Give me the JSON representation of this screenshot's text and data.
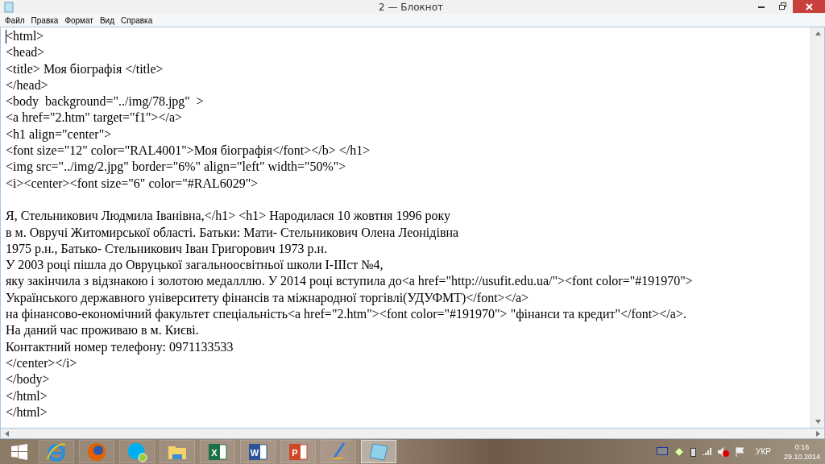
{
  "window": {
    "title": "2 — Блокнот"
  },
  "menu": [
    "Файл",
    "Правка",
    "Формат",
    "Вид",
    "Справка"
  ],
  "editor": {
    "blocks": [
      [
        "<html>",
        "<head>",
        "<title> Моя біографія </title>",
        "</head>",
        "<body  background=\"../img/78.jpg\"  >",
        "<a href=\"2.htm\" target=\"f1\"></a>",
        "<h1 align=\"center\">",
        "<font size=\"12\" color=\"RAL4001\">Моя біографія</font></b> </h1>",
        "<img src=\"../img/2.jpg\" border=\"6%\" align=\"left\" width=\"50%\">",
        "<i><center><font size=\"6\" color=\"#RAL6029\">"
      ],
      [
        "Я, Стельникович Людмила Іванівна,</h1> <h1> Народилася 10 жовтня 1996 року",
        "в м. Овручі Житомирської області. Батьки: Мати- Стельникович Олена Леонідівна",
        "1975 р.н., Батько- Стельникович Іван Григорович 1973 р.н.",
        "У 2003 році пішла до Овруцької загальноосвітньої школи І-ІІІст №4,",
        "яку закінчила з відзнакою і золотою медалллю. У 2014 році вступила до<a href=\"http://usufit.edu.ua/\"><font color=\"#191970\">",
        "Українського державного університету фінансів та міжнародної торгівлі(УДУФМТ)</font></a>",
        "на фінансово-економічний факультет спеціальність<a href=\"2.htm\"><font color=\"#191970\"> \"фінанси та кредит\"</font></a>.",
        "На даний час проживаю в м. Києві.",
        "Контактний номер телефону: 0971133533",
        "</center></i>",
        "</body>",
        "</html>",
        "</html>"
      ]
    ]
  },
  "taskbar": {
    "apps": [
      {
        "kind": "ie",
        "selected": false
      },
      {
        "kind": "firefox",
        "selected": false
      },
      {
        "kind": "skype",
        "selected": false
      },
      {
        "kind": "explorer",
        "selected": false
      },
      {
        "kind": "office",
        "color": "#1e7145",
        "letter": "X",
        "selected": false
      },
      {
        "kind": "office",
        "color": "#2b579a",
        "letter": "W",
        "selected": false
      },
      {
        "kind": "office",
        "color": "#d24726",
        "letter": "P",
        "selected": false
      },
      {
        "kind": "pen",
        "selected": false
      },
      {
        "kind": "notepad",
        "selected": true
      }
    ],
    "language": "УКР",
    "time": "0:16",
    "date": "29.10.2014"
  }
}
